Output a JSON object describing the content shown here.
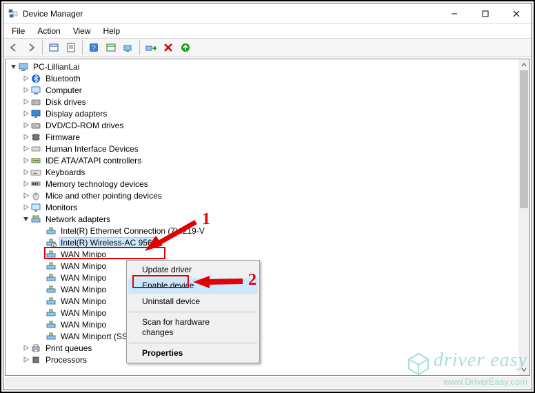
{
  "window": {
    "title": "Device Manager"
  },
  "menubar": [
    "File",
    "Action",
    "View",
    "Help"
  ],
  "toolbar_icons": [
    "back-arrow",
    "forward-arrow",
    "show-hidden",
    "properties-sheet",
    "help-icon",
    "refresh-icon",
    "update-driver-icon",
    "enable-icon",
    "disable-x-icon",
    "scan-hardware-up-icon"
  ],
  "tree": {
    "root": "PC-LillianLai",
    "top_items": [
      "Bluetooth",
      "Computer",
      "Disk drives",
      "Display adapters",
      "DVD/CD-ROM drives",
      "Firmware",
      "Human Interface Devices",
      "IDE ATA/ATAPI controllers",
      "Keyboards",
      "Memory technology devices",
      "Mice and other pointing devices",
      "Monitors"
    ],
    "network_label": "Network adapters",
    "network_children": [
      "Intel(R) Ethernet Connection (7) I219-V",
      "Intel(R) Wireless-AC 9560",
      "WAN Minipo",
      "WAN Minipo",
      "WAN Minipo",
      "WAN Minipo",
      "WAN Minipo",
      "WAN Minipo",
      "WAN Minipo",
      "WAN Miniport (SSTP)"
    ],
    "selected_index": 1,
    "bottom_items": [
      "Print queues",
      "Processors"
    ]
  },
  "context_menu": {
    "items": [
      "Update driver",
      "Enable device",
      "Uninstall device",
      "__sep__",
      "Scan for hardware changes",
      "__sep__",
      "Properties"
    ],
    "highlighted_index": 1,
    "bold_index": 6
  },
  "annotations": {
    "label1": "1",
    "label2": "2"
  },
  "watermark": {
    "brand": "driver easy",
    "url": "www.DriverEasy.com"
  }
}
